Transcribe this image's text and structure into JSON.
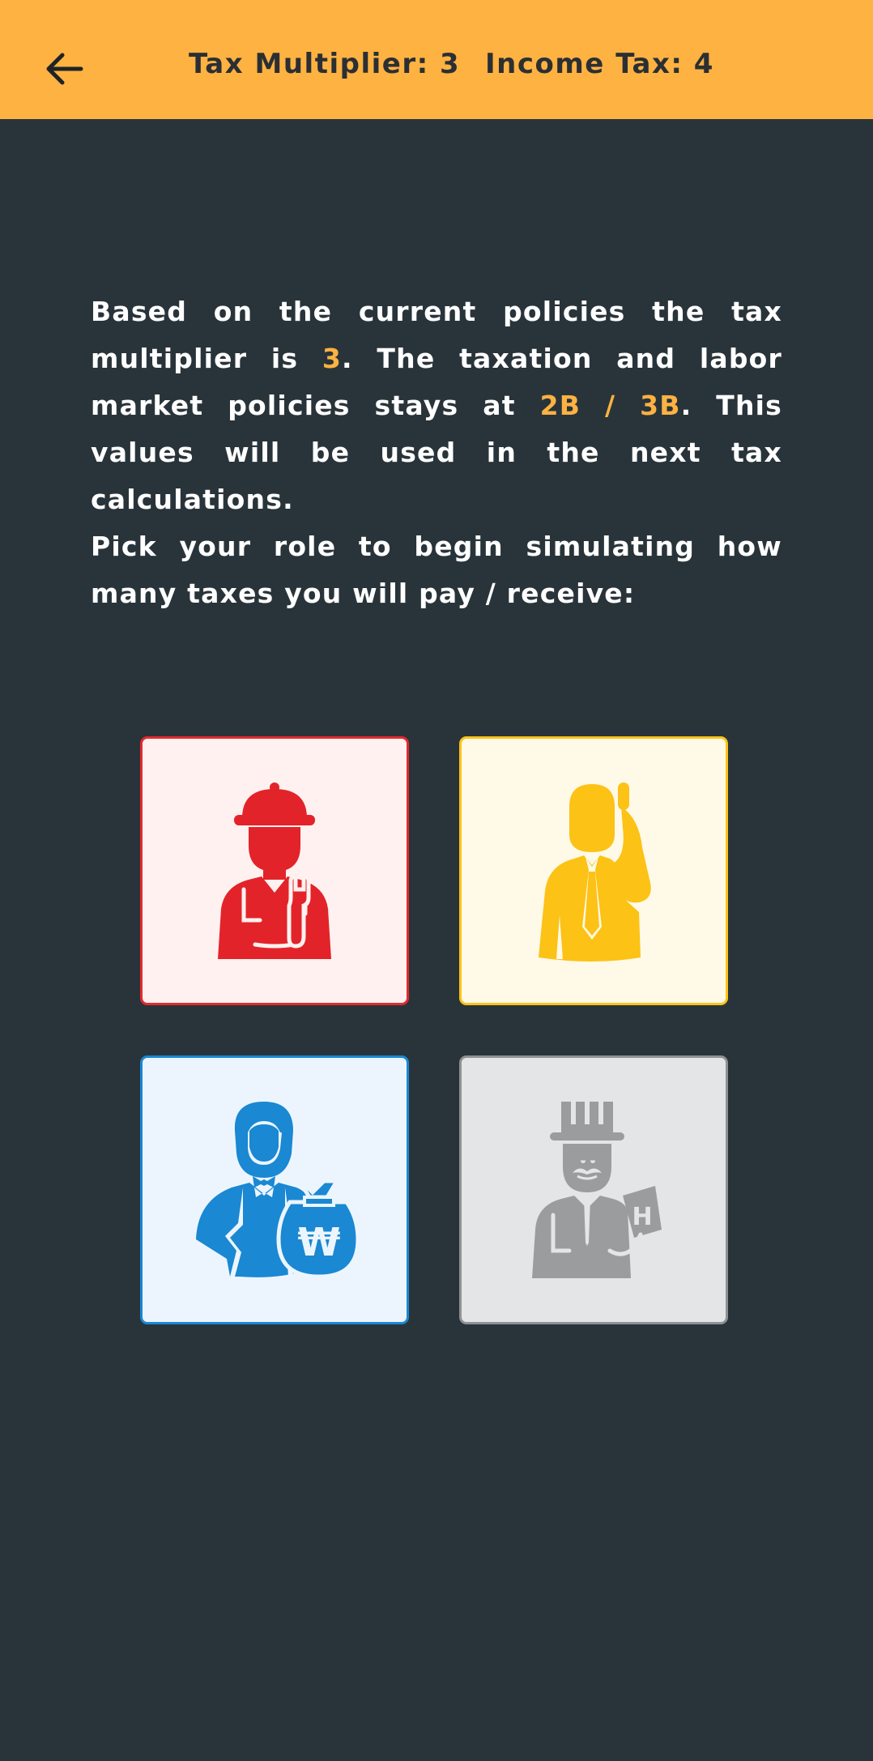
{
  "header": {
    "back_icon": "arrow-left-icon",
    "tax_multiplier_label": "Tax Multiplier: 3",
    "income_tax_label": "Income Tax: 4"
  },
  "intro": {
    "p1_a": "Based on the current policies the tax multiplier is ",
    "p1_multiplier": "3",
    "p1_b": ". The taxation and labor market policies stays at ",
    "p1_policy": "2B / 3B",
    "p1_c": ". This values will be used in the next tax calculations.",
    "p2": "Pick your role to begin simulating how many taxes you will pay / receive:"
  },
  "roles": [
    {
      "id": "worker",
      "icon": "worker-icon",
      "color": "#e3232a"
    },
    {
      "id": "employee",
      "icon": "businessman-phone-icon",
      "color": "#fcc215"
    },
    {
      "id": "investor",
      "icon": "investor-money-bag-icon",
      "glyph": "₩",
      "color": "#1a88d2"
    },
    {
      "id": "owner",
      "icon": "capitalist-top-hat-icon",
      "glyph": "H",
      "color": "#9b9c9e"
    }
  ],
  "colors": {
    "header_bg": "#fdb242",
    "page_bg": "#29343a",
    "highlight": "#fdb242"
  }
}
